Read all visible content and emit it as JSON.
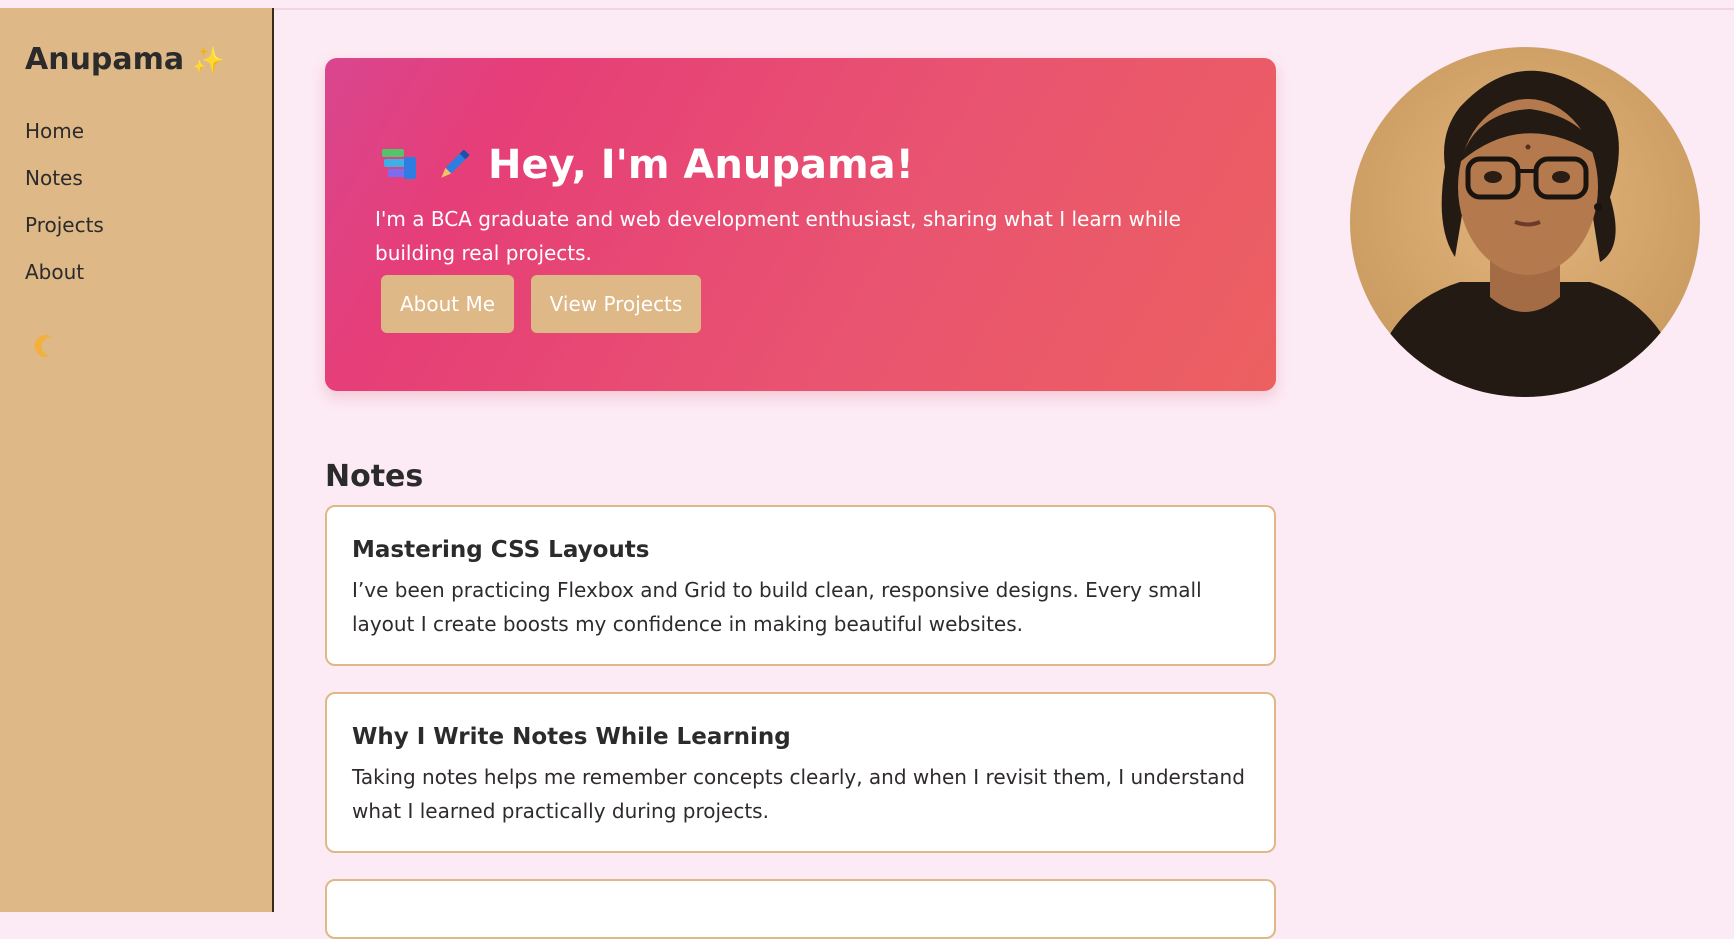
{
  "sidebar": {
    "brand": "Anupama",
    "brand_icon": "sparkles-icon",
    "nav": [
      "Home",
      "Notes",
      "Projects",
      "About"
    ],
    "theme_toggle_icon": "moon-icon"
  },
  "hero": {
    "icons": [
      "books-icon",
      "pen-icon"
    ],
    "title": "Hey, I'm Anupama!",
    "subtitle": "I'm a BCA graduate and web development enthusiast, sharing what I learn while building real projects.",
    "buttons": [
      "About Me",
      "View Projects"
    ]
  },
  "notes": {
    "heading": "Notes",
    "items": [
      {
        "title": "Mastering CSS Layouts",
        "text": "I’ve been practicing Flexbox and Grid to build clean, responsive designs. Every small layout I create boosts my confidence in making beautiful websites."
      },
      {
        "title": "Why I Write Notes While Learning",
        "text": "Taking notes helps me remember concepts clearly, and when I revisit them, I understand what I learned practically during projects."
      }
    ]
  },
  "colors": {
    "accent": "#deb887",
    "hero_start": "#d9468f",
    "hero_end": "#ec6060",
    "background": "#fcebf4"
  }
}
